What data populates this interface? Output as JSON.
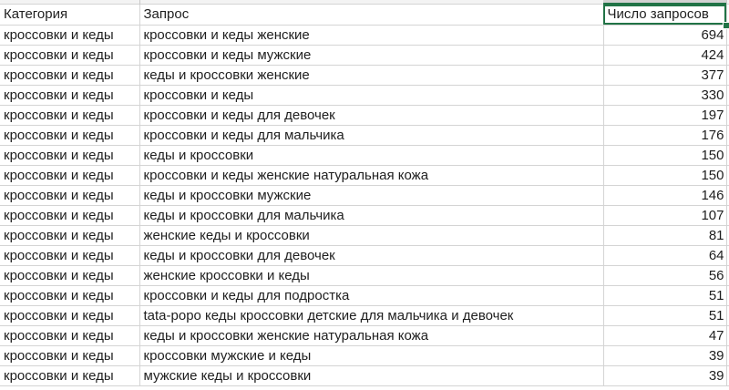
{
  "headers": {
    "category": "Категория",
    "query": "Запрос",
    "count": "Число запросов"
  },
  "rows": [
    {
      "category": "кроссовки и кеды",
      "query": "кроссовки и кеды женские",
      "count": "694"
    },
    {
      "category": "кроссовки и кеды",
      "query": "кроссовки и кеды мужские",
      "count": "424"
    },
    {
      "category": "кроссовки и кеды",
      "query": "кеды и кроссовки женские",
      "count": "377"
    },
    {
      "category": "кроссовки и кеды",
      "query": "кроссовки и кеды",
      "count": "330"
    },
    {
      "category": "кроссовки и кеды",
      "query": "кроссовки и кеды для девочек",
      "count": "197"
    },
    {
      "category": "кроссовки и кеды",
      "query": "кроссовки и кеды для мальчика",
      "count": "176"
    },
    {
      "category": "кроссовки и кеды",
      "query": "кеды и кроссовки",
      "count": "150"
    },
    {
      "category": "кроссовки и кеды",
      "query": "кроссовки и кеды женские натуральная кожа",
      "count": "150"
    },
    {
      "category": "кроссовки и кеды",
      "query": "кеды и кроссовки мужские",
      "count": "146"
    },
    {
      "category": "кроссовки и кеды",
      "query": "кеды и кроссовки для мальчика",
      "count": "107"
    },
    {
      "category": "кроссовки и кеды",
      "query": "женские кеды и кроссовки",
      "count": "81"
    },
    {
      "category": "кроссовки и кеды",
      "query": "кеды и кроссовки для девочек",
      "count": "64"
    },
    {
      "category": "кроссовки и кеды",
      "query": "женские кроссовки и кеды",
      "count": "56"
    },
    {
      "category": "кроссовки и кеды",
      "query": "кроссовки и кеды для подростка",
      "count": "51"
    },
    {
      "category": "кроссовки и кеды",
      "query": "tata-poро кеды кроссовки детские для мальчика и девочек",
      "count": "51"
    },
    {
      "category": "кроссовки и кеды",
      "query": "кеды и кроссовки женские натуральная кожа",
      "count": "47"
    },
    {
      "category": "кроссовки и кеды",
      "query": "кроссовки мужские и кеды",
      "count": "39"
    },
    {
      "category": "кроссовки и кеды",
      "query": "мужские кеды и кроссовки",
      "count": "39"
    }
  ],
  "accent_color": "#217346"
}
